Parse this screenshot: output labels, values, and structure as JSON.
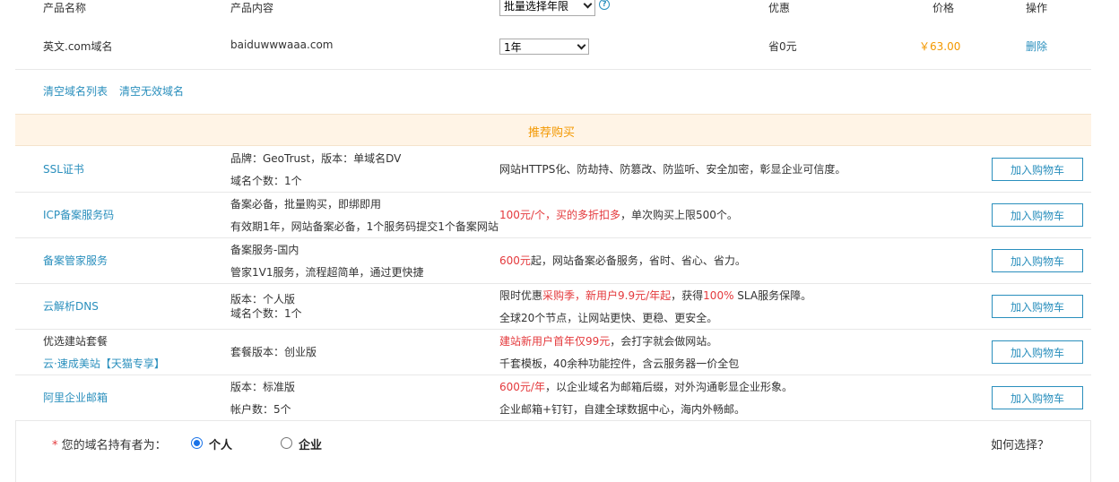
{
  "header": {
    "product_name": "产品名称",
    "product_content": "产品内容",
    "batch_select": "批量选择年限",
    "discount": "优惠",
    "price": "价格",
    "action": "操作"
  },
  "cart_item": {
    "name": "英文.com域名",
    "content": "baiduwwwaaa.com",
    "years": "1年",
    "discount": "省0元",
    "price": "￥63.00",
    "delete": "删除"
  },
  "list_actions": {
    "clear_list": "清空域名列表",
    "clear_invalid": "清空无效域名"
  },
  "recommend": {
    "title": "推荐购买",
    "add_to_cart": "加入购物车",
    "items": [
      {
        "name": "SSL证书",
        "content_line1": "品牌：GeoTrust，版本：单域名DV",
        "content_line2": "域名个数：1个",
        "desc_line1": "网站HTTPS化、防劫持、防篡改、防监听、安全加密，彰显企业可信度。"
      },
      {
        "name": "ICP备案服务码",
        "content_line1": "备案必备，批量购买，即绑即用",
        "content_line2": "有效期1年，网站备案必备，1个服务码提交1个备案网站",
        "desc_red": "100元/个，买的多折扣多",
        "desc_rest": "，单次购买上限500个。"
      },
      {
        "name": "备案管家服务",
        "content_line1": "备案服务-国内",
        "content_line2": "管家1V1服务，流程超简单，通过更快捷",
        "desc_red": "600元",
        "desc_rest": "起，网站备案必备服务，省时、省心、省力。"
      },
      {
        "name": "云解析DNS",
        "content_line1": "版本：个人版",
        "content_line2": "域名个数：1个",
        "desc_p1": "限时优惠",
        "desc_p2": "采购季，新用户9.9元/年起",
        "desc_p3": "，获得",
        "desc_p4": "100%",
        "desc_p5": " SLA服务保障。",
        "desc_line2": "全球20个节点，让网站更快、更稳、更安全。"
      },
      {
        "name_line1": "优选建站套餐",
        "name_line2": "云·速成美站【天猫专享】",
        "content_line1": "套餐版本：创业版",
        "desc_red": "建站新用户首年仅99元",
        "desc_rest": "，会打字就会做网站。",
        "desc_line2": "千套模板，40余种功能控件，含云服务器一价全包"
      },
      {
        "name": "阿里企业邮箱",
        "content_line1": "版本：标准版",
        "content_line2": "帐户数：5个",
        "desc_red": "600元/年",
        "desc_rest": "，以企业域名为邮箱后缀，对外沟通彰显企业形象。",
        "desc_line2": "企业邮箱+钉钉，自建全球数据中心，海内外畅邮。"
      }
    ]
  },
  "owner": {
    "asterisk": "*",
    "label": "您的域名持有者为：",
    "personal": "个人",
    "enterprise": "企业",
    "how_to_choose": "如何选择？"
  },
  "colors": {
    "link": "#2a8fbd",
    "red": "#e4393c",
    "orange": "#f39800",
    "recommend_band": "#fff4e6"
  }
}
